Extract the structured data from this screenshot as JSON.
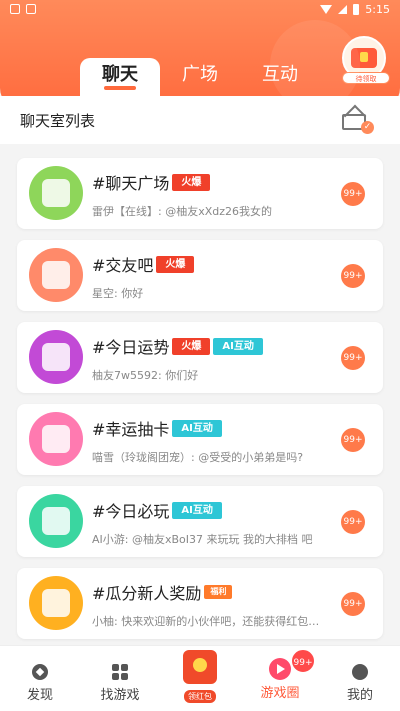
{
  "status_bar": {
    "time": "5:15"
  },
  "header": {
    "tabs": [
      {
        "label": "聊天",
        "active": true
      },
      {
        "label": "广场",
        "active": false
      },
      {
        "label": "互动",
        "active": false
      }
    ],
    "gift_label": "待领取"
  },
  "section": {
    "title": "聊天室列表"
  },
  "rooms": [
    {
      "name": "#聊天广场",
      "tags": [
        "火爆"
      ],
      "last_message": "雷伊【在线】: @柚友xXdz26我女的",
      "count": "99+",
      "avatar_color": "#8ed65a"
    },
    {
      "name": "#交友吧",
      "tags": [
        "火爆"
      ],
      "last_message": "星空: 你好",
      "count": "99+",
      "avatar_color": "#ff8a6a"
    },
    {
      "name": "#今日运势",
      "tags": [
        "火爆",
        "AI互动"
      ],
      "last_message": "柚友7w5592: 你们好",
      "count": "99+",
      "avatar_color": "#c24ad6"
    },
    {
      "name": "#幸运抽卡",
      "tags": [
        "AI互动"
      ],
      "last_message": "喵雪（玲珑阁团宠）: @受受的小弟弟是吗?",
      "count": "99+",
      "avatar_color": "#ff7ab0"
    },
    {
      "name": "#今日必玩",
      "tags": [
        "AI互动"
      ],
      "last_message": "AI小游: @柚友xBoI37 来玩玩 我的大排档 吧",
      "count": "99+",
      "avatar_color": "#3ad6a0"
    },
    {
      "name": "#瓜分新人奖励",
      "tags": [
        "福利"
      ],
      "last_message": "小柚: 快来欢迎新的小伙伴吧，还能获得红包币...",
      "count": "99+",
      "avatar_color": "#ffb020"
    }
  ],
  "bottom_nav": {
    "items": [
      {
        "label": "发现"
      },
      {
        "label": "找游戏"
      },
      {
        "label": "领红包"
      },
      {
        "label": "游戏圈"
      },
      {
        "label": "我的"
      }
    ],
    "badge": "99+"
  },
  "colors": {
    "accent": "#ff6a3d",
    "hot_tag": "#f0402a",
    "ai_tag": "#2ec6d6"
  }
}
